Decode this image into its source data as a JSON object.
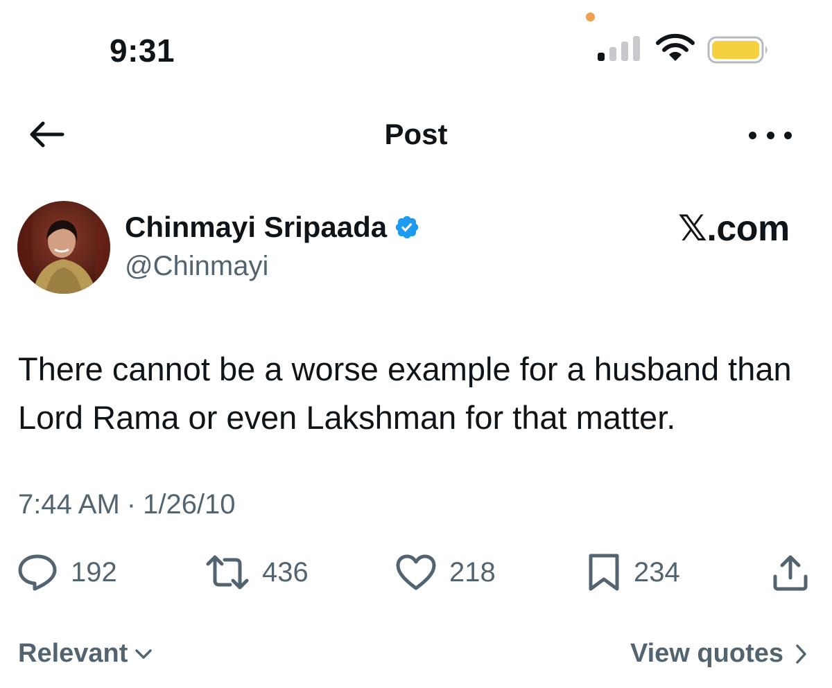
{
  "status_bar": {
    "time": "9:31",
    "signal_bars_active": 1,
    "signal_bars_total": 4,
    "battery_color": "#f5d142",
    "camera_indicator_color": "#f0a050"
  },
  "header": {
    "title": "Post",
    "back_icon": "arrow-left-icon",
    "more_icon": "more-horizontal-icon"
  },
  "author": {
    "display_name": "Chinmayi Sripaada",
    "handle": "@Chinmayi",
    "verified": true,
    "verified_color": "#1d9bf0"
  },
  "watermark": "𝕏.com",
  "post": {
    "text": "There cannot be a worse example for a husband than Lord Rama or even Lakshman for that matter.",
    "time": "7:44 AM",
    "separator": "·",
    "date": "1/26/10"
  },
  "actions": {
    "replies": "192",
    "reposts": "436",
    "likes": "218",
    "bookmarks": "234"
  },
  "footer": {
    "sort_label": "Relevant",
    "view_quotes_label": "View quotes"
  },
  "colors": {
    "text_primary": "#0f1419",
    "text_secondary": "#536471",
    "verified_blue": "#1d9bf0"
  }
}
